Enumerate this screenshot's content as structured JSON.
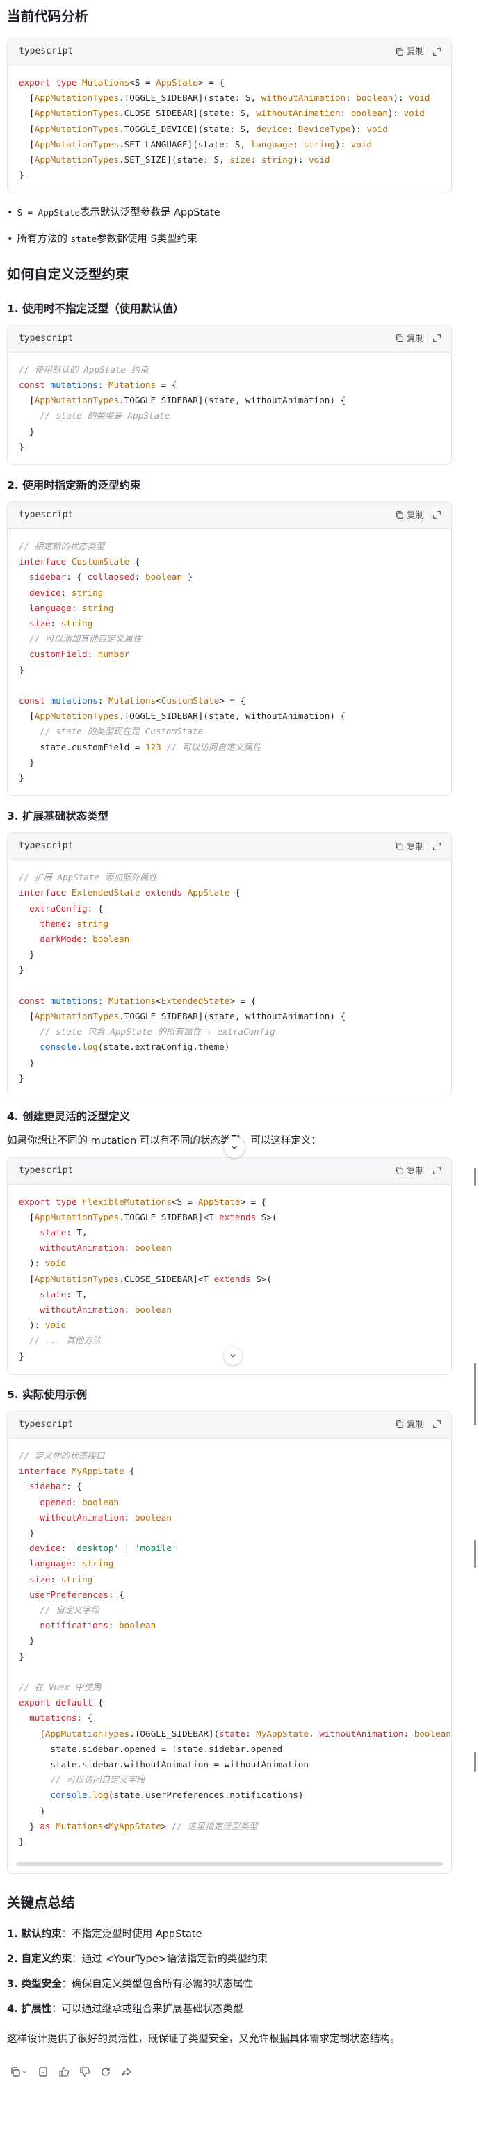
{
  "section_current": {
    "heading": "当前代码分析"
  },
  "code_lang": "typescript",
  "copy_label": "复制",
  "bullets": {
    "b1_pre": "S = AppState",
    "b1_post": "表示默认泛型参数是 AppState",
    "b2_pre": "所有方法的 ",
    "b2_code": "state",
    "b2_post": "参数都使用 S类型约束"
  },
  "section_custom": {
    "heading": "如何自定义泛型约束"
  },
  "sub1": "1. 使用时不指定泛型（使用默认值）",
  "sub2": "2. 使用时指定新的泛型约束",
  "sub3": "3. 扩展基础状态类型",
  "sub4": "4. 创建更灵活的泛型定义",
  "sub4_desc": "如果你想让不同的 mutation 可以有不同的状态类型，可以这样定义：",
  "sub5": "5. 实际使用示例",
  "section_points": {
    "heading": "关键点总结"
  },
  "points": [
    {
      "label": "1. 默认约束",
      "text": "：不指定泛型时使用 AppState"
    },
    {
      "label": "2. 自定义约束",
      "text": "：通过 <YourType>语法指定新的类型约束"
    },
    {
      "label": "3. 类型安全",
      "text": "：确保自定义类型包含所有必需的状态属性"
    },
    {
      "label": "4. 扩展性",
      "text": "：可以通过继承或组合来扩展基础状态类型"
    }
  ],
  "closing": "这样设计提供了很好的灵活性，既保证了类型安全，又允许根据具体需求定制状态结构。",
  "icons": [
    "copy-icon",
    "expand-icon",
    "chevron-down-icon",
    "bookmark-icon",
    "thumbs-up-icon",
    "thumbs-down-icon",
    "refresh-icon",
    "share-icon"
  ]
}
